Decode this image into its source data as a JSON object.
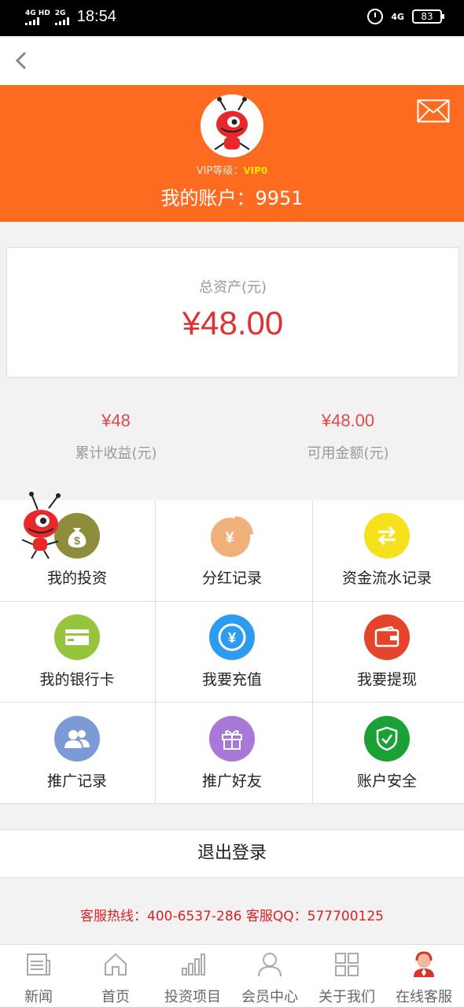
{
  "status_bar": {
    "net1": "4G HD",
    "net2": "2G",
    "time": "18:54",
    "net3": "4G",
    "battery": "83"
  },
  "header": {
    "vip_label": "VIP等级：",
    "vip_level": "VIP0",
    "account_label": "我的账户：9951"
  },
  "asset": {
    "label": "总资产(元)",
    "value": "¥48.00"
  },
  "stats": [
    {
      "value": "¥48",
      "label": "累计收益(元)"
    },
    {
      "value": "¥48.00",
      "label": "可用金额(元)"
    }
  ],
  "grid": [
    {
      "label": "我的投资",
      "icon": "money-bag-icon",
      "color": "#8d8d3b",
      "glyph": "$"
    },
    {
      "label": "分红记录",
      "icon": "pie-chart-icon",
      "color": "#f0b07a",
      "glyph": "¥"
    },
    {
      "label": "资金流水记录",
      "icon": "transfer-icon",
      "color": "#f5e21c",
      "glyph": "⇄"
    },
    {
      "label": "我的银行卡",
      "icon": "bank-card-icon",
      "color": "#96c43c",
      "glyph": "▭"
    },
    {
      "label": "我要充值",
      "icon": "recharge-icon",
      "color": "#2d9cf0",
      "glyph": "¥"
    },
    {
      "label": "我要提现",
      "icon": "wallet-icon",
      "color": "#e5432b",
      "glyph": "▣"
    },
    {
      "label": "推广记录",
      "icon": "users-icon",
      "color": "#7b9ad6",
      "glyph": "👥"
    },
    {
      "label": "推广好友",
      "icon": "gift-icon",
      "color": "#a878d6",
      "glyph": "🎁"
    },
    {
      "label": "账户安全",
      "icon": "shield-icon",
      "color": "#1aa035",
      "glyph": "✓"
    }
  ],
  "logout_label": "退出登录",
  "hotline": "客服热线：400-6537-286 客服QQ：577700125",
  "tabs": [
    {
      "label": "新闻",
      "icon": "news-icon"
    },
    {
      "label": "首页",
      "icon": "home-icon"
    },
    {
      "label": "投资项目",
      "icon": "bar-chart-icon"
    },
    {
      "label": "会员中心",
      "icon": "user-icon"
    },
    {
      "label": "关于我们",
      "icon": "grid-icon"
    },
    {
      "label": "在线客服",
      "icon": "service-icon"
    }
  ],
  "colors": {
    "accent": "#fd6b21",
    "price": "#d33333",
    "hotline": "#dd2222"
  }
}
